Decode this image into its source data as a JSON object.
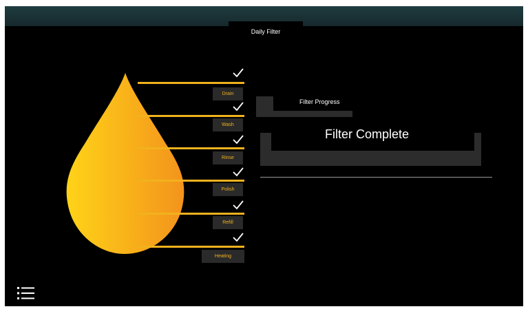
{
  "header": {
    "title": "Daily Filter"
  },
  "steps": [
    {
      "label": "Drain",
      "completed": true
    },
    {
      "label": "Wash",
      "completed": true
    },
    {
      "label": "Rinse",
      "completed": true
    },
    {
      "label": "Polish",
      "completed": true
    },
    {
      "label": "Refill",
      "completed": true
    },
    {
      "label": "Heating",
      "completed": false
    }
  ],
  "progress": {
    "label": "Filter Progress",
    "status": "Filter Complete"
  },
  "icons": {
    "menu": "list-menu-icon",
    "check": "checkmark-icon",
    "drop": "water-drop-icon"
  },
  "colors": {
    "accent": "#f2b21d",
    "drop_gradient_start": "#ffd318",
    "drop_gradient_end": "#f3931c",
    "header_bar": "#1b3538",
    "panel_gray": "#2c2c2c"
  }
}
